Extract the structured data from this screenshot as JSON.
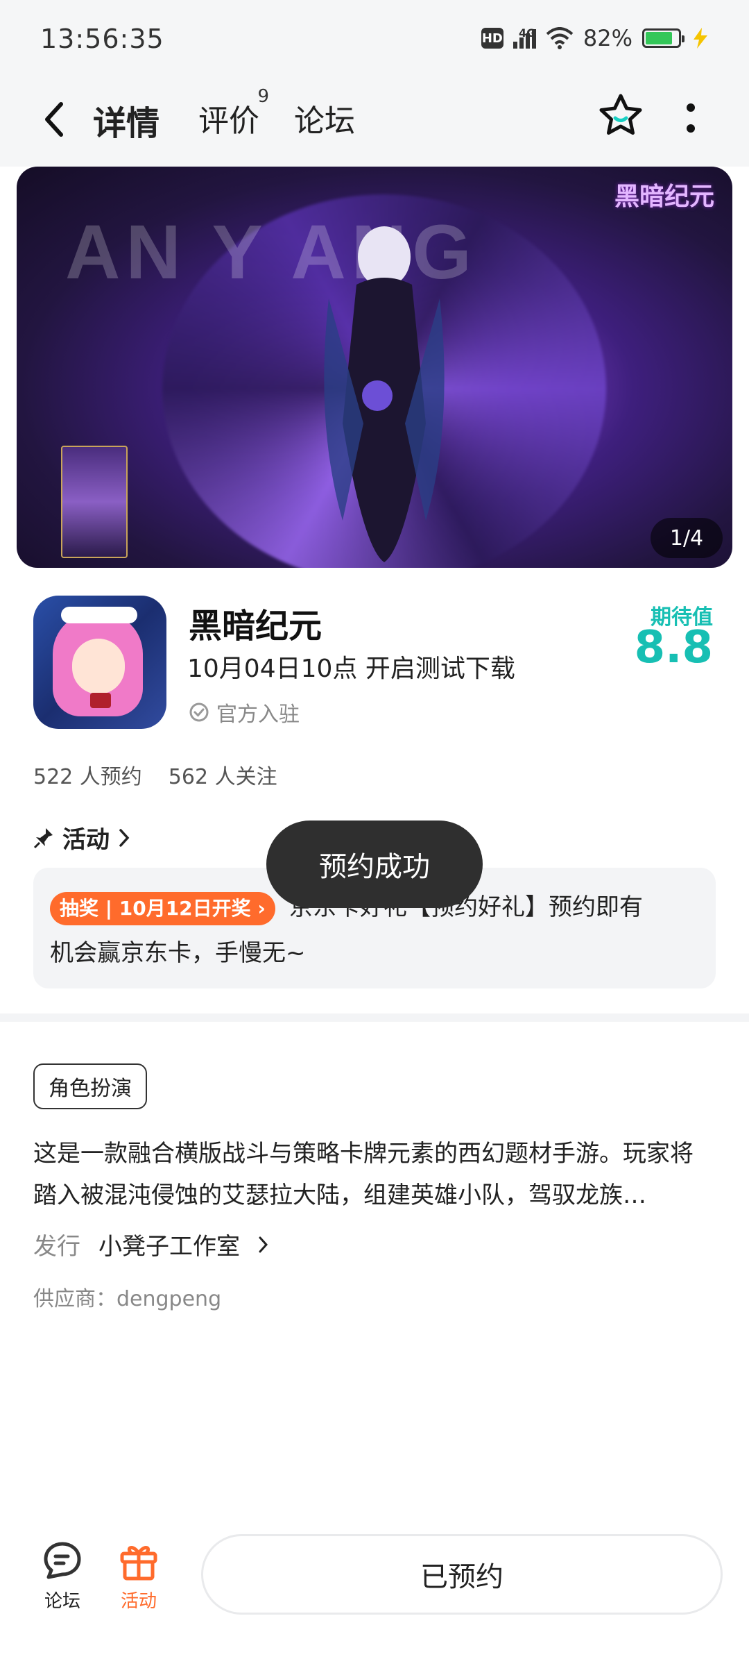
{
  "status_bar": {
    "time": "13:56:35",
    "hd": "HD",
    "network": "4G",
    "battery": "82%",
    "battery_level": 0.82
  },
  "nav": {
    "tabs": [
      {
        "label": "详情",
        "active": true
      },
      {
        "label": "评价",
        "count": "9"
      },
      {
        "label": "论坛"
      }
    ],
    "accent_color": "#17d0c3"
  },
  "banner": {
    "bg_text": "AN Y  ANG",
    "logo": "黑暗纪元",
    "counter": "1/4"
  },
  "game": {
    "title": "黑暗纪元",
    "subtitle": "10月04日10点 开启测试下载",
    "official": "官方入驻",
    "expect_label": "期待值",
    "expect_value": "8.8",
    "stats": {
      "reservations": "522 人预约",
      "followers": "562 人关注"
    }
  },
  "activity": {
    "header": "活动",
    "tag": "抽奖 | 10月12日开奖",
    "line1": "京东卡好礼【预约好礼】预约即有",
    "line2": "机会赢京东卡，手慢无~"
  },
  "toast": "预约成功",
  "details": {
    "genre": "角色扮演",
    "description": "这是一款融合横版战斗与策略卡牌元素的西幻题材手游。玩家将踏入被混沌侵蚀的艾瑟拉大陆，组建英雄小队，驾驭龙族…",
    "publisher_label": "发行",
    "publisher": "小凳子工作室",
    "supplier": "供应商：dengpeng"
  },
  "bottom_bar": {
    "forum_label": "论坛",
    "activity_label": "活动",
    "reserved_label": "已预约",
    "activity_color": "#ff6b2c"
  }
}
